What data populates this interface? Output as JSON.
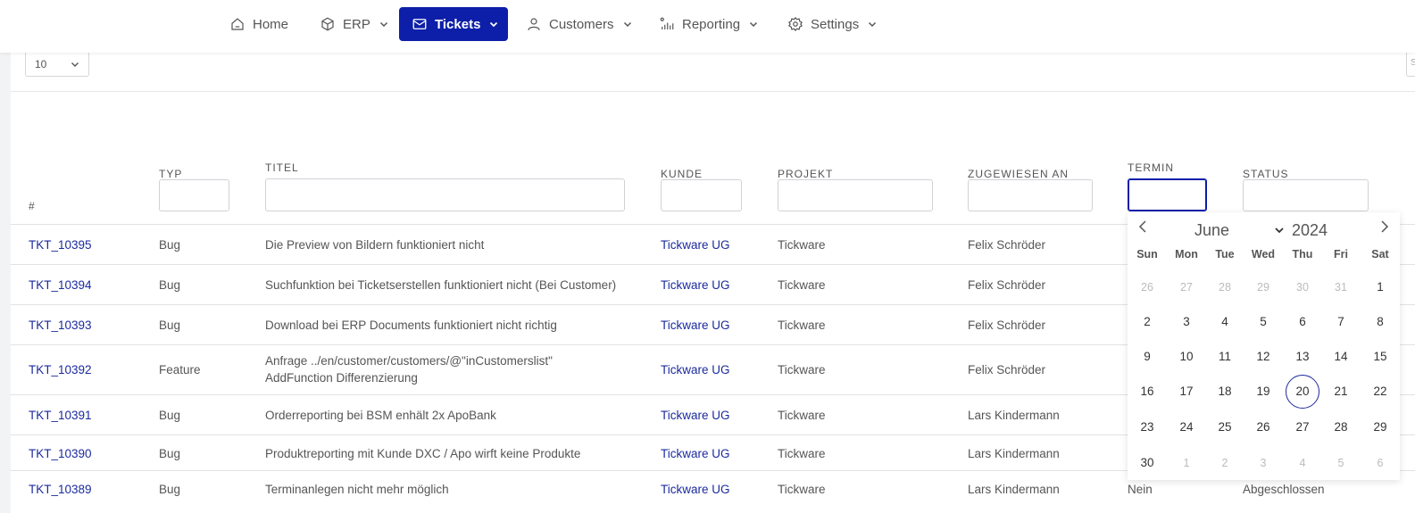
{
  "nav": {
    "items": [
      {
        "label": "Home",
        "icon": "home-icon",
        "has_menu": false,
        "active": false
      },
      {
        "label": "ERP",
        "icon": "cube-icon",
        "has_menu": true,
        "active": false
      },
      {
        "label": "Tickets",
        "icon": "mail-icon",
        "has_menu": true,
        "active": true
      },
      {
        "label": "Customers",
        "icon": "user-icon",
        "has_menu": true,
        "active": false
      },
      {
        "label": "Reporting",
        "icon": "chart-bars-icon",
        "has_menu": true,
        "active": false
      },
      {
        "label": "Settings",
        "icon": "gear-icon",
        "has_menu": true,
        "active": false
      }
    ]
  },
  "page_size": {
    "value": "10"
  },
  "search_stub": "S",
  "table": {
    "headers": {
      "num": "#",
      "typ": "TYP",
      "titel": "TITEL",
      "kunde": "KUNDE",
      "projekt": "PROJEKT",
      "zugewiesen": "ZUGEWIESEN AN",
      "termin": "TERMIN",
      "status": "STATUS"
    },
    "rows": [
      {
        "id": "TKT_10395",
        "typ": "Bug",
        "titel": "Die Preview von Bildern funktioniert nicht",
        "titel2": "",
        "kunde": "Tickware UG",
        "projekt": "Tickware",
        "zugewiesen": "Felix Schröder",
        "termin": "",
        "status": ""
      },
      {
        "id": "TKT_10394",
        "typ": "Bug",
        "titel": "Suchfunktion bei Ticketserstellen funktioniert nicht (Bei Customer)",
        "titel2": "",
        "kunde": "Tickware UG",
        "projekt": "Tickware",
        "zugewiesen": "Felix Schröder",
        "termin": "",
        "status": ""
      },
      {
        "id": "TKT_10393",
        "typ": "Bug",
        "titel": "Download bei ERP Documents funktioniert nicht richtig",
        "titel2": "",
        "kunde": "Tickware UG",
        "projekt": "Tickware",
        "zugewiesen": "Felix Schröder",
        "termin": "",
        "status": ""
      },
      {
        "id": "TKT_10392",
        "typ": "Feature",
        "titel": "Anfrage ../en/customer/customers/@\"inCustomerslist\"",
        "titel2": "AddFunction Differenzierung",
        "kunde": "Tickware UG",
        "projekt": "Tickware",
        "zugewiesen": "Felix Schröder",
        "termin": "",
        "status": ""
      },
      {
        "id": "TKT_10391",
        "typ": "Bug",
        "titel": "Orderreporting bei BSM enhält 2x ApoBank",
        "titel2": "",
        "kunde": "Tickware UG",
        "projekt": "Tickware",
        "zugewiesen": "Lars Kindermann",
        "termin": "",
        "status": ""
      },
      {
        "id": "TKT_10390",
        "typ": "Bug",
        "titel": "Produktreporting mit Kunde DXC / Apo wirft keine Produkte",
        "titel2": "",
        "kunde": "Tickware UG",
        "projekt": "Tickware",
        "zugewiesen": "Lars Kindermann",
        "termin": "",
        "status": ""
      },
      {
        "id": "TKT_10389",
        "typ": "Bug",
        "titel": "Terminanlegen nicht mehr möglich",
        "titel2": "",
        "kunde": "Tickware UG",
        "projekt": "Tickware",
        "zugewiesen": "Lars Kindermann",
        "termin": "Nein",
        "status": "Abgeschlossen"
      }
    ]
  },
  "datepicker": {
    "month": "June",
    "year": "2024",
    "weekdays": [
      "Sun",
      "Mon",
      "Tue",
      "Wed",
      "Thu",
      "Fri",
      "Sat"
    ],
    "weeks": [
      [
        [
          "26",
          1
        ],
        [
          "27",
          1
        ],
        [
          "28",
          1
        ],
        [
          "29",
          1
        ],
        [
          "30",
          1
        ],
        [
          "31",
          1
        ],
        [
          "1",
          0
        ]
      ],
      [
        [
          "2",
          0
        ],
        [
          "3",
          0
        ],
        [
          "4",
          0
        ],
        [
          "5",
          0
        ],
        [
          "6",
          0
        ],
        [
          "7",
          0
        ],
        [
          "8",
          0
        ]
      ],
      [
        [
          "9",
          0
        ],
        [
          "10",
          0
        ],
        [
          "11",
          0
        ],
        [
          "12",
          0
        ],
        [
          "13",
          0
        ],
        [
          "14",
          0
        ],
        [
          "15",
          0
        ]
      ],
      [
        [
          "16",
          0
        ],
        [
          "17",
          0
        ],
        [
          "18",
          0
        ],
        [
          "19",
          0
        ],
        [
          "20",
          2
        ],
        [
          "21",
          0
        ],
        [
          "22",
          0
        ]
      ],
      [
        [
          "23",
          0
        ],
        [
          "24",
          0
        ],
        [
          "25",
          0
        ],
        [
          "26",
          0
        ],
        [
          "27",
          0
        ],
        [
          "28",
          0
        ],
        [
          "29",
          0
        ]
      ],
      [
        [
          "30",
          0
        ],
        [
          "1",
          1
        ],
        [
          "2",
          1
        ],
        [
          "3",
          1
        ],
        [
          "4",
          1
        ],
        [
          "5",
          1
        ],
        [
          "6",
          1
        ]
      ]
    ]
  },
  "colors": {
    "accent": "#0d1fa8",
    "link": "#1b2a9e"
  }
}
